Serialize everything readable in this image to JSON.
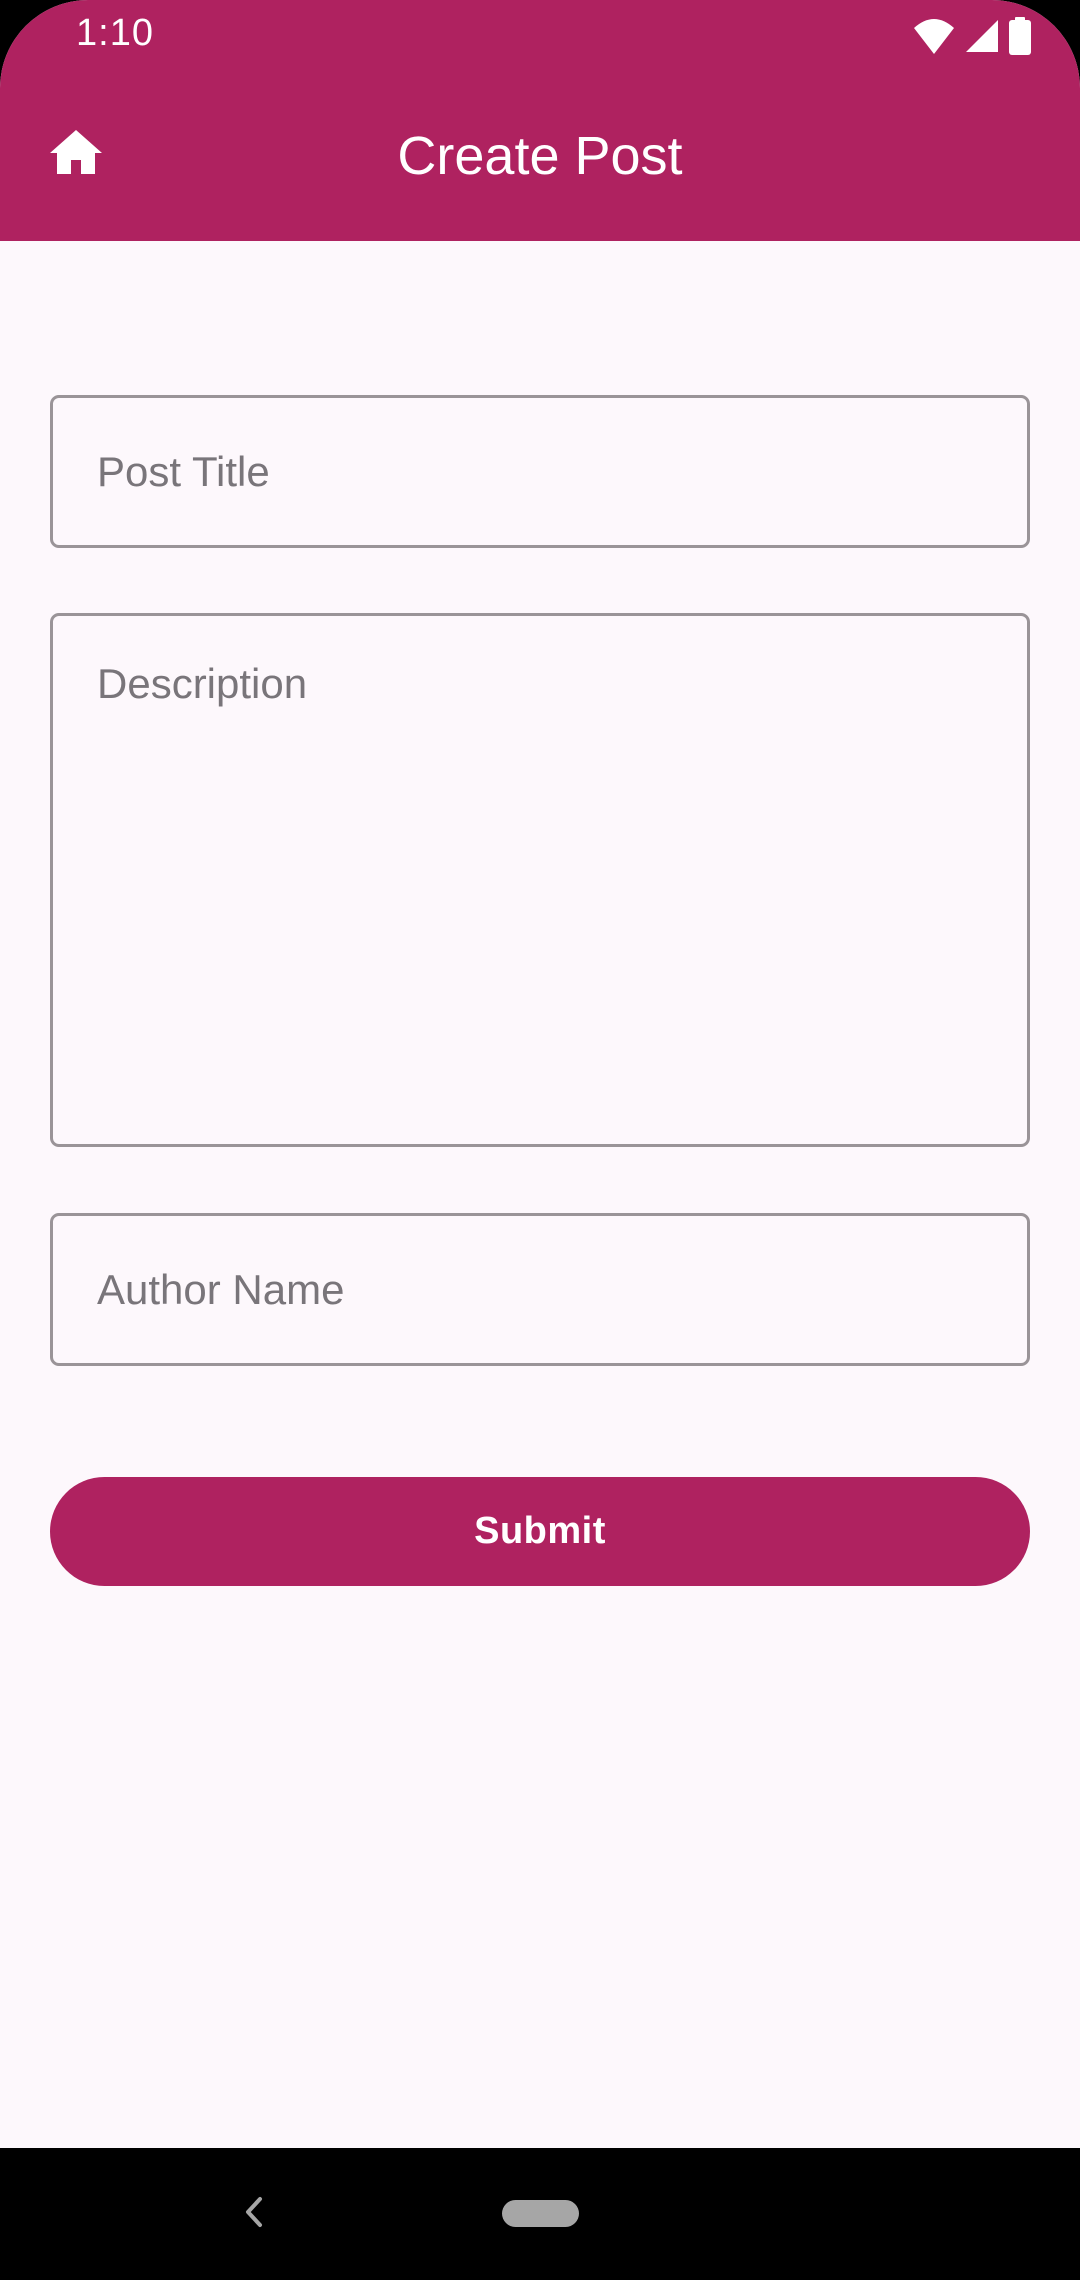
{
  "status_bar": {
    "time": "1:10",
    "icons": [
      "wifi-icon",
      "signal-icon",
      "battery-icon"
    ]
  },
  "app_bar": {
    "title": "Create Post",
    "home_icon": "home-icon"
  },
  "form": {
    "post_title": {
      "placeholder": "Post Title",
      "value": ""
    },
    "description": {
      "placeholder": "Description",
      "value": ""
    },
    "author_name": {
      "placeholder": "Author Name",
      "value": ""
    },
    "submit_label": "Submit"
  },
  "nav_bar": {
    "back_icon": "back-icon",
    "home_pill": "home-pill-icon"
  },
  "colors": {
    "primary": "#AF2260",
    "background": "#FDF8FC",
    "outline": "#9A9498",
    "placeholder": "#79757A"
  }
}
